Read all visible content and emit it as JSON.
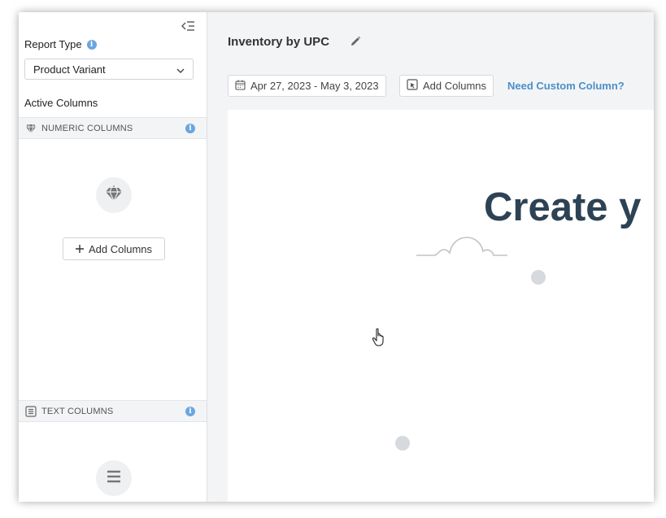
{
  "sidebar": {
    "report_type_label": "Report Type",
    "report_type_value": "Product Variant",
    "active_columns_label": "Active Columns",
    "numeric_section": {
      "label": "NUMERIC COLUMNS",
      "add_button_label": "Add Columns"
    },
    "text_section": {
      "label": "TEXT COLUMNS"
    }
  },
  "main": {
    "title": "Inventory by UPC",
    "date_range": "Apr 27, 2023 - May 3, 2023",
    "add_columns_label": "Add Columns",
    "custom_column_link": "Need Custom Column?",
    "empty_state_text": "Create y"
  },
  "colors": {
    "accent": "#4a90c8",
    "info": "#6aa6de",
    "heading_dark": "#2d4254",
    "panel_bg": "#f3f4f6"
  },
  "icons": [
    "collapse-sidebar-icon",
    "info-icon",
    "chevron-down-icon",
    "diamond-icon",
    "plus-icon",
    "text-list-icon",
    "pencil-icon",
    "calendar-icon",
    "add-column-icon",
    "cloud-icon",
    "hand-cursor-icon"
  ]
}
